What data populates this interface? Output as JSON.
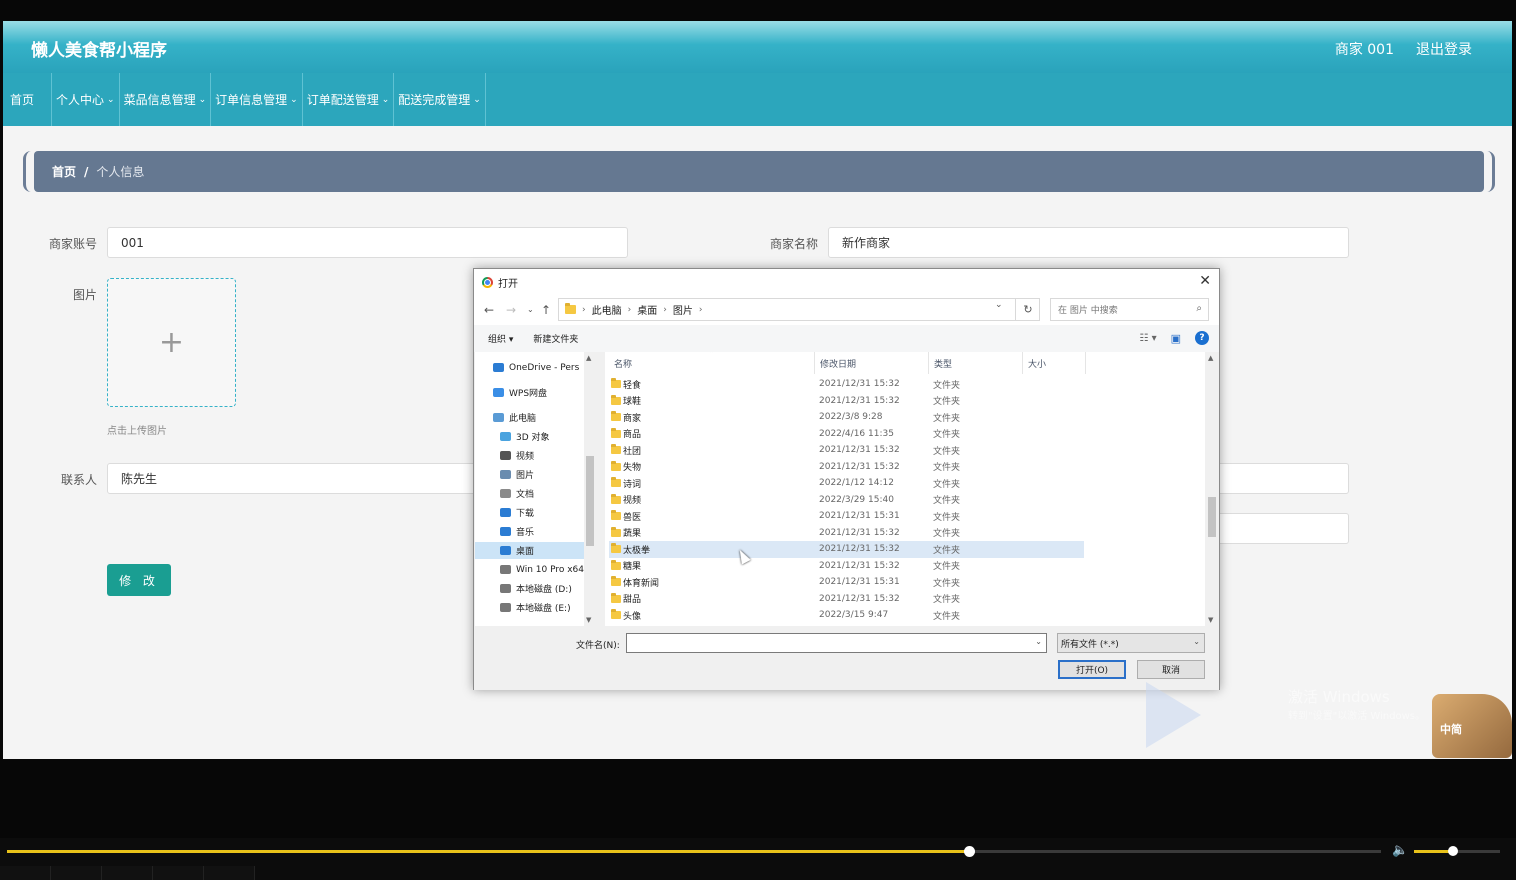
{
  "app": {
    "brand": "懒人美食帮小程序",
    "user": "商家 001",
    "logout": "退出登录",
    "nav": [
      {
        "label": "首页",
        "dropdown": false
      },
      {
        "label": "个人中心",
        "dropdown": true
      },
      {
        "label": "菜品信息管理",
        "dropdown": true
      },
      {
        "label": "订单信息管理",
        "dropdown": true
      },
      {
        "label": "订单配送管理",
        "dropdown": true
      },
      {
        "label": "配送完成管理",
        "dropdown": true
      }
    ],
    "breadcrumb": {
      "home": "首页",
      "sep": "/",
      "current": "个人信息"
    },
    "form": {
      "account_label": "商家账号",
      "account_value": "001",
      "name_label": "商家名称",
      "name_value": "新作商家",
      "image_label": "图片",
      "upload_plus": "+",
      "upload_tip": "点击上传图片",
      "contact_label": "联系人",
      "contact_value": "陈先生",
      "submit": "修 改"
    }
  },
  "dialog": {
    "title": "打开",
    "close": "✕",
    "address": [
      "此电脑",
      "桌面",
      "图片"
    ],
    "search_placeholder": "在 图片 中搜索",
    "toolbar": {
      "organize": "组织 ▾",
      "new_folder": "新建文件夹"
    },
    "nav_pane": [
      {
        "label": "OneDrive - Pers",
        "icon": "cloud-icon",
        "color": "#2b7cd3"
      },
      {
        "label": "WPS网盘",
        "icon": "cloud-icon",
        "color": "#3a8ee6"
      },
      {
        "label": "此电脑",
        "icon": "pc-icon",
        "color": "#5a9bd5"
      },
      {
        "label": "3D 对象",
        "icon": "cube-icon",
        "color": "#4aa3df"
      },
      {
        "label": "视频",
        "icon": "video-icon",
        "color": "#555555"
      },
      {
        "label": "图片",
        "icon": "picture-icon",
        "color": "#6a8caf"
      },
      {
        "label": "文档",
        "icon": "document-icon",
        "color": "#8a8a8a"
      },
      {
        "label": "下载",
        "icon": "download-icon",
        "color": "#2b7cd3"
      },
      {
        "label": "音乐",
        "icon": "music-icon",
        "color": "#2b7cd3"
      },
      {
        "label": "桌面",
        "icon": "desktop-icon",
        "color": "#2b7cd3",
        "selected": true
      },
      {
        "label": "Win 10 Pro x64",
        "icon": "drive-icon",
        "color": "#777777"
      },
      {
        "label": "本地磁盘 (D:)",
        "icon": "drive-icon",
        "color": "#777777"
      },
      {
        "label": "本地磁盘 (E:)",
        "icon": "drive-icon",
        "color": "#777777"
      }
    ],
    "columns": [
      "名称",
      "修改日期",
      "类型",
      "大小"
    ],
    "files": [
      {
        "name": "轻食",
        "date": "2021/12/31 15:32",
        "type": "文件夹"
      },
      {
        "name": "球鞋",
        "date": "2021/12/31 15:32",
        "type": "文件夹"
      },
      {
        "name": "商家",
        "date": "2022/3/8 9:28",
        "type": "文件夹"
      },
      {
        "name": "商品",
        "date": "2022/4/16 11:35",
        "type": "文件夹"
      },
      {
        "name": "社团",
        "date": "2021/12/31 15:32",
        "type": "文件夹"
      },
      {
        "name": "失物",
        "date": "2021/12/31 15:32",
        "type": "文件夹"
      },
      {
        "name": "诗词",
        "date": "2022/1/12 14:12",
        "type": "文件夹"
      },
      {
        "name": "视频",
        "date": "2022/3/29 15:40",
        "type": "文件夹"
      },
      {
        "name": "兽医",
        "date": "2021/12/31 15:31",
        "type": "文件夹"
      },
      {
        "name": "蔬果",
        "date": "2021/12/31 15:32",
        "type": "文件夹"
      },
      {
        "name": "太极拳",
        "date": "2021/12/31 15:32",
        "type": "文件夹",
        "selected": true
      },
      {
        "name": "糖果",
        "date": "2021/12/31 15:32",
        "type": "文件夹"
      },
      {
        "name": "体育新闻",
        "date": "2021/12/31 15:31",
        "type": "文件夹"
      },
      {
        "name": "甜品",
        "date": "2021/12/31 15:32",
        "type": "文件夹"
      },
      {
        "name": "头像",
        "date": "2022/3/15 9:47",
        "type": "文件夹"
      }
    ],
    "filename_label": "文件名(N):",
    "filename_value": "",
    "filetype": "所有文件 (*.*)",
    "open": "打开(O)",
    "cancel": "取消"
  },
  "overlay": {
    "watermark_line1": "激活 Windows",
    "watermark_line2": "转到\"设置\"以激活 Windows。",
    "mascot_text": "中简"
  },
  "player": {
    "progress": 0.7,
    "volume": 0.45
  },
  "colors": {
    "header": "#2ca6bc",
    "breadcrumb": "#657891",
    "button": "#1a9e92",
    "progress": "#e8c21a"
  }
}
